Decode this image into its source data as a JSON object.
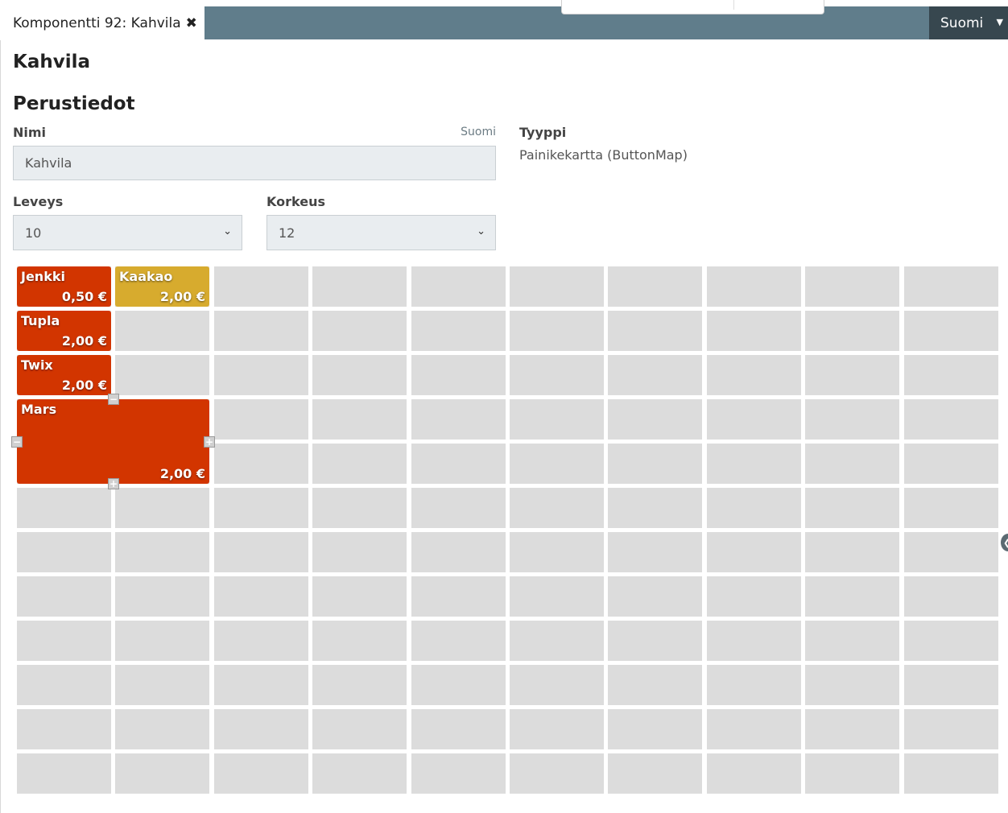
{
  "tab": {
    "label": "Komponentti 92: Kahvila",
    "close_icon": "close-icon"
  },
  "language": {
    "selected": "Suomi"
  },
  "page": {
    "title": "Kahvila"
  },
  "section": {
    "title": "Perustiedot"
  },
  "form": {
    "name_label": "Nimi",
    "name_lang": "Suomi",
    "name_value": "Kahvila",
    "type_label": "Tyyppi",
    "type_value": "Painikekartta (ButtonMap)",
    "width_label": "Leveys",
    "width_value": "10",
    "height_label": "Korkeus",
    "height_value": "12"
  },
  "grid": {
    "columns": 10,
    "rows": 12,
    "buttons": [
      {
        "name": "Jenkki",
        "price": "0,50 €",
        "col": 0,
        "row": 0,
        "colspan": 1,
        "rowspan": 1,
        "color": "#d23500"
      },
      {
        "name": "Kaakao",
        "price": "2,00 €",
        "col": 1,
        "row": 0,
        "colspan": 1,
        "rowspan": 1,
        "color": "#d7ab2e"
      },
      {
        "name": "Tupla",
        "price": "2,00 €",
        "col": 0,
        "row": 1,
        "colspan": 1,
        "rowspan": 1,
        "color": "#d23500"
      },
      {
        "name": "Twix",
        "price": "2,00 €",
        "col": 0,
        "row": 2,
        "colspan": 1,
        "rowspan": 1,
        "color": "#d23500"
      },
      {
        "name": "Mars",
        "price": "2,00 €",
        "col": 0,
        "row": 3,
        "colspan": 2,
        "rowspan": 2,
        "color": "#d23500"
      }
    ]
  },
  "colors": {
    "header_bar": "#607d8b",
    "language_button": "#37474f",
    "empty_cell": "#dcdcdc"
  }
}
